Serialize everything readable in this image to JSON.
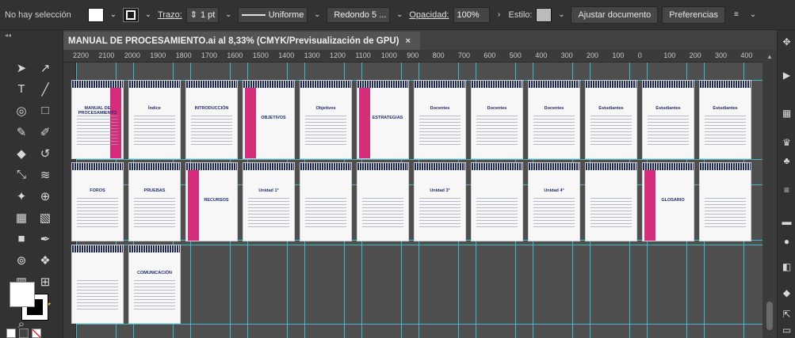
{
  "control_bar": {
    "selection_label": "No hay selección",
    "stroke_label": "Trazo:",
    "stroke_value": "1 pt",
    "profile_value": "Uniforme",
    "brush_value": "Redondo 5 ...",
    "opacity_label": "Opacidad:",
    "opacity_value": "100%",
    "style_label": "Estilo:",
    "fit_button": "Ajustar documento",
    "prefs_button": "Preferencias"
  },
  "document_tab": {
    "title": "MANUAL DE PROCESAMIENTO.ai al 8,33% (CMYK/Previsualización de GPU)",
    "close": "×"
  },
  "ruler": {
    "ticks": [
      "2200",
      "2100",
      "2000",
      "1900",
      "1800",
      "1700",
      "1600",
      "1500",
      "1400",
      "1300",
      "1200",
      "1100",
      "1000",
      "900",
      "800",
      "700",
      "600",
      "500",
      "400",
      "300",
      "200",
      "100",
      "0",
      "100",
      "200",
      "300",
      "400"
    ]
  },
  "artboards": [
    {
      "title": "MANUAL DE PROCESAMIENTO",
      "pink": true
    },
    {
      "title": "Índice"
    },
    {
      "title": "INTRODUCCIÓN"
    },
    {
      "title": "OBJETIVOS",
      "stripe": true
    },
    {
      "title": "Objetivos"
    },
    {
      "title": "ESTRATEGIAS",
      "stripe": true
    },
    {
      "title": "Docentes"
    },
    {
      "title": "Docentes"
    },
    {
      "title": "Docentes"
    },
    {
      "title": "Estudiantes"
    },
    {
      "title": "Estudiantes"
    },
    {
      "title": "Estudiantes"
    },
    {
      "title": "FOROS"
    },
    {
      "title": "PRUEBAS"
    },
    {
      "title": "RECURSOS",
      "stripe": true
    },
    {
      "title": "Unidad 1°"
    },
    {
      "title": ""
    },
    {
      "title": ""
    },
    {
      "title": "Unidad 3°"
    },
    {
      "title": ""
    },
    {
      "title": "Unidad 4°"
    },
    {
      "title": ""
    },
    {
      "title": "GLOSARIO",
      "stripe": true
    },
    {
      "title": ""
    },
    {
      "title": ""
    },
    {
      "title": "COMUNICACIÓN"
    }
  ],
  "toolbar": {
    "tools": [
      "selection-icon",
      "direct-selection-icon",
      "type-icon",
      "line-icon",
      "ellipse-icon",
      "rectangle-icon",
      "brush-icon",
      "pencil-icon",
      "eraser-icon",
      "rotate-icon",
      "scale-icon",
      "warp-icon",
      "pin-icon",
      "shape-builder-icon",
      "mesh-icon",
      "perspective-icon",
      "gradient-icon",
      "eyedropper-icon",
      "blend-icon",
      "symbol-icon",
      "graph-icon",
      "artboard-icon",
      "slice-icon",
      "hand-icon",
      "zoom-icon"
    ]
  }
}
